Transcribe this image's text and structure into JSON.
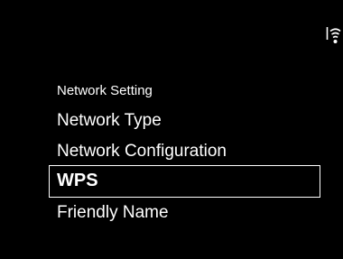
{
  "status": {
    "icon": "wifi-signal-icon"
  },
  "menu": {
    "title": "Network Setting",
    "items": [
      {
        "label": "Network Type",
        "selected": false
      },
      {
        "label": "Network Configuration",
        "selected": false
      },
      {
        "label": "WPS",
        "selected": true
      },
      {
        "label": "Friendly Name",
        "selected": false
      }
    ]
  },
  "colors": {
    "background": "#000000",
    "text": "#ffffff",
    "selection_border": "#ffffff"
  }
}
